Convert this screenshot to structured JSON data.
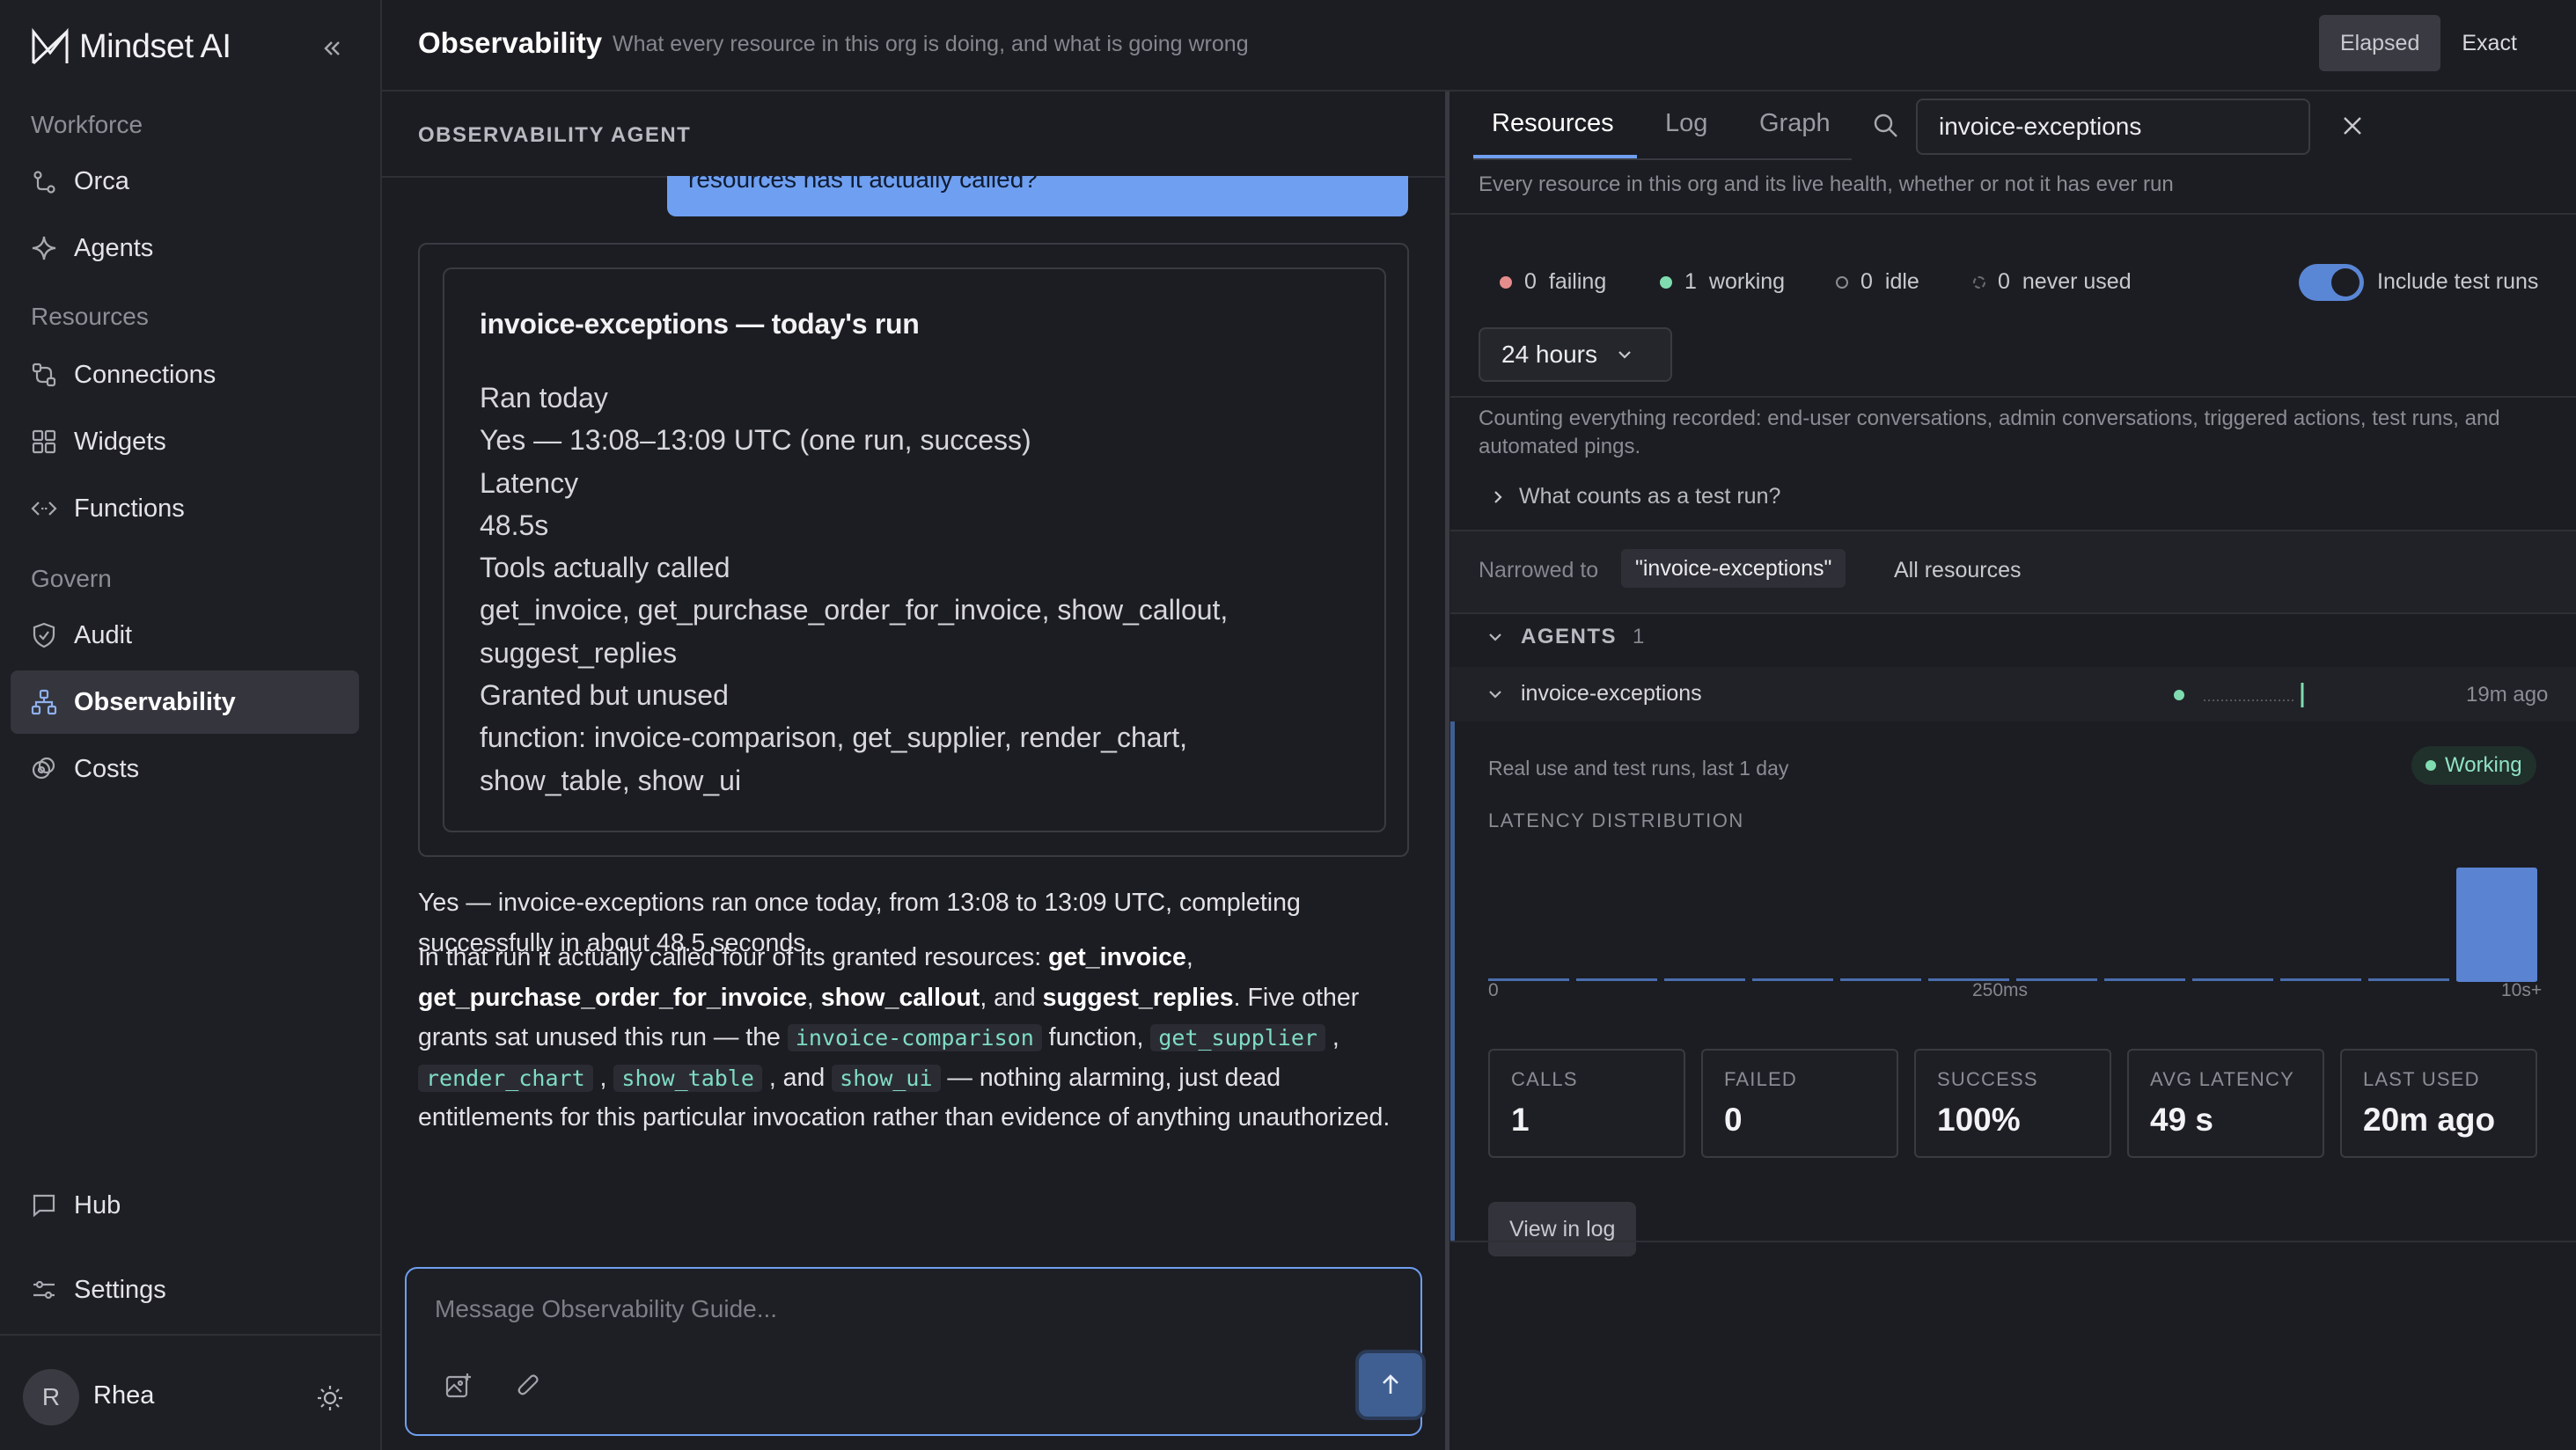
{
  "brand": {
    "name": "Mindset AI"
  },
  "sidebar": {
    "sections": [
      {
        "label": "Workforce"
      },
      {
        "label": "Resources"
      },
      {
        "label": "Govern"
      }
    ],
    "items": [
      {
        "label": "Orca",
        "icon": "orca-icon"
      },
      {
        "label": "Agents",
        "icon": "sparkle-icon"
      },
      {
        "label": "Connections",
        "icon": "connections-icon"
      },
      {
        "label": "Widgets",
        "icon": "grid-icon"
      },
      {
        "label": "Functions",
        "icon": "code-icon"
      },
      {
        "label": "Audit",
        "icon": "shield-icon"
      },
      {
        "label": "Observability",
        "icon": "network-icon",
        "active": true
      },
      {
        "label": "Costs",
        "icon": "coins-icon"
      },
      {
        "label": "Hub",
        "icon": "chat-icon"
      },
      {
        "label": "Settings",
        "icon": "sliders-icon"
      }
    ],
    "user": {
      "initial": "R",
      "name": "Rhea"
    }
  },
  "header": {
    "title": "Observability",
    "subtitle": "What every resource in this org is doing, and what is going wrong",
    "toggle": {
      "elapsed": "Elapsed",
      "exact": "Exact",
      "selected": "Elapsed"
    }
  },
  "agent": {
    "label": "OBSERVABILITY AGENT",
    "user_message_tail": "resources has it actually called?",
    "card": {
      "title": "invoice-exceptions — today's run",
      "lines": [
        "Ran today",
        "Yes — 13:08–13:09 UTC (one run, success)",
        "Latency",
        "48.5s",
        "Tools actually called",
        "get_invoice, get_purchase_order_for_invoice, show_callout,",
        "suggest_replies",
        "Granted but unused",
        "function: invoice-comparison, get_supplier, render_chart,",
        "show_table, show_ui"
      ]
    },
    "reply1": "Yes — invoice-exceptions ran once today, from 13:08 to 13:09 UTC, completing successfully in about 48.5 seconds.",
    "reply2": {
      "t1": "In that run it actually called four of its granted resources: ",
      "b1": "get_invoice",
      "t2": ", ",
      "b2": "get_purchase_order_for_invoice",
      "t3": ", ",
      "b3": "show_callout",
      "t4": ", and ",
      "b4": "suggest_replies",
      "t5": ". Five other grants sat unused this run — the ",
      "c1": "invoice-comparison",
      "t6": " function, ",
      "c2": "get_supplier",
      "t7": " , ",
      "c3": "render_chart",
      "t8": " , ",
      "c4": "show_table",
      "t9": " , and ",
      "c5": "show_ui",
      "t10": " — nothing alarming, just dead entitlements for this particular invocation rather than evidence of anything unauthorized."
    },
    "composer_placeholder": "Message Observability Guide..."
  },
  "right": {
    "tabs": [
      "Resources",
      "Log",
      "Graph"
    ],
    "active_tab": "Resources",
    "search_value": "invoice-exceptions",
    "subtitle": "Every resource in this org and its live health, whether or not it has ever run",
    "stats": [
      {
        "count": "0",
        "label": "failing",
        "color": "#e58c8c"
      },
      {
        "count": "1",
        "label": "working",
        "color": "#7fdcb0"
      },
      {
        "count": "0",
        "label": "idle",
        "color": "#8b8c94"
      },
      {
        "count": "0",
        "label": "never used",
        "color": "#6a6b72"
      }
    ],
    "include_test_runs": "Include test runs",
    "include_test_runs_on": true,
    "range": "24 hours",
    "counting": "Counting everything recorded: end-user conversations, admin conversations, triggered actions, test runs, and automated pings.",
    "what_counts": "What counts as a test run?",
    "narrowed_label": "Narrowed to",
    "narrowed_value": "\"invoice-exceptions\"",
    "all_resources": "All resources",
    "agents_header": "AGENTS",
    "agents_count": "1",
    "resource": {
      "name": "invoice-exceptions",
      "last": "19m ago",
      "detail_sub": "Real use and test runs, last 1 day",
      "status": "Working",
      "latency_label": "LATENCY DISTRIBUTION",
      "ticks": [
        "0",
        "250ms",
        "10s+"
      ],
      "metrics": [
        {
          "label": "CALLS",
          "value": "1"
        },
        {
          "label": "FAILED",
          "value": "0"
        },
        {
          "label": "SUCCESS",
          "value": "100%"
        },
        {
          "label": "AVG LATENCY",
          "value": "49 s"
        },
        {
          "label": "LAST USED",
          "value": "20m ago"
        }
      ],
      "view_log": "View in log"
    }
  },
  "chart_data": {
    "type": "bar",
    "categories": [
      "1",
      "2",
      "3",
      "4",
      "5",
      "6",
      "7",
      "8",
      "9",
      "10",
      "11",
      "12"
    ],
    "values": [
      0,
      0,
      0,
      0,
      0,
      0,
      0,
      0,
      0,
      0,
      0,
      1
    ],
    "xlabel": "",
    "ylabel": "",
    "xticks": [
      "0",
      "250ms",
      "10s+"
    ]
  }
}
